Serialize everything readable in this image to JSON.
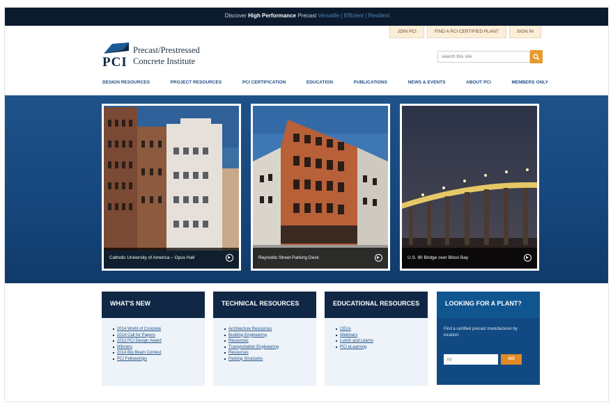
{
  "topbar": {
    "prefix": "Discover ",
    "highlight": "High Performance",
    "suffix": " Precast",
    "links": " Versatile | Efficient | Resilient"
  },
  "util": [
    "JOIN PCI",
    "FIND A PCI CERTIFIED PLANT",
    "SIGN IN"
  ],
  "logo": {
    "abbr": "PCI",
    "line1": "Precast/Prestressed",
    "line2": "Concrete Institute"
  },
  "search": {
    "placeholder": "search this site"
  },
  "nav": [
    "DESIGN RESOURCES",
    "PROJECT RESOURCES",
    "PCI CERTIFICATION",
    "EDUCATION",
    "PUBLICATIONS",
    "NEWS & EVENTS",
    "ABOUT PCI",
    "MEMBERS ONLY"
  ],
  "slides": [
    {
      "caption": "Catholic University of America – Opus Hall"
    },
    {
      "caption": "Reynolds Street Parking Deck"
    },
    {
      "caption": "U.S. 90 Bridge over Biloxi Bay"
    }
  ],
  "boxes": [
    {
      "title": "WHAT'S NEW",
      "items": [
        "2014 World of Concrete",
        "2014 Call for Papers",
        "2013 PCI Design Award",
        "Winners",
        "2014 Big Beam Contest",
        "PCI Fellowships"
      ]
    },
    {
      "title": "TECHNICAL RESOURCES",
      "items": [
        "Architecture Resources",
        "Building Engineering",
        "Resources",
        "Transportation Engineering",
        "Resources",
        "Parking Structures"
      ]
    },
    {
      "title": "EDUCATIONAL RESOURCES",
      "items": [
        "CEUs",
        "Webinars",
        "Lunch and Learns",
        "PCI eLearning"
      ]
    }
  ],
  "plant": {
    "title": "LOOKING FOR A PLANT?",
    "text": "Find a certified precast manufacturer by location:",
    "zip_placeholder": "zip",
    "go": "GO"
  },
  "colors": {
    "navy": "#0b1a2d",
    "brand_blue": "#16477d",
    "accent_orange": "#e79a2c"
  }
}
